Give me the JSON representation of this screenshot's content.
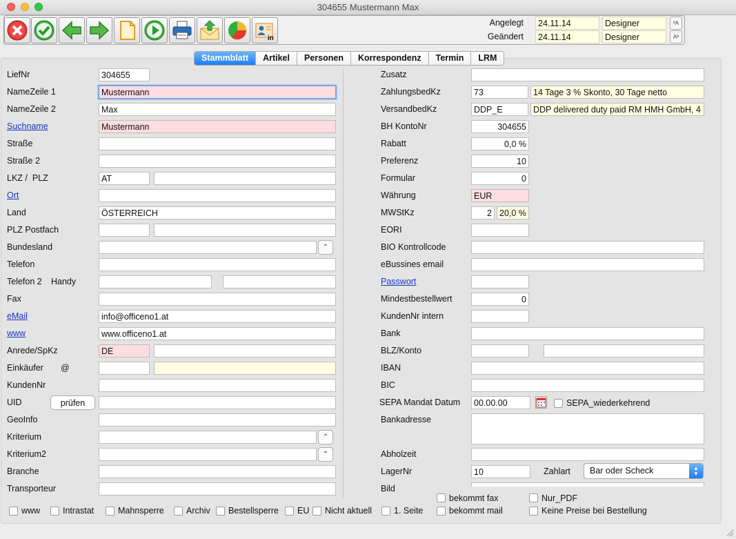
{
  "window": {
    "title": "304655 Mustermann Max"
  },
  "toolbar": {
    "buttons": [
      "cancel-icon",
      "check-icon",
      "back-arrow-icon",
      "forward-arrow-icon",
      "new-document-icon",
      "play-icon",
      "print-icon",
      "mail-upload-icon",
      "pie-chart-icon",
      "contact-card-icon"
    ]
  },
  "header": {
    "angelegt_label": "Angelegt",
    "angelegt_date": "24.11.14",
    "angelegt_user": "Designer",
    "geaendert_label": "Geändert",
    "geaendert_date": "24.11.14",
    "geaendert_user": "Designer"
  },
  "tabs": [
    "Stammblatt",
    "Artikel",
    "Personen",
    "Korrespondenz",
    "Termin",
    "LRM"
  ],
  "left": {
    "liefnr_label": "LiefNr",
    "liefnr": "304655",
    "name1_label": "NameZeile 1",
    "name1": "Mustermann",
    "name2_label": "NameZeile 2",
    "name2": "Max",
    "suchname_label": "Suchname",
    "suchname": "Mustermann",
    "strasse_label": "Straße",
    "strasse": "",
    "strasse2_label": "Straße 2",
    "strasse2": "",
    "lkzplz_label": "LKZ /  PLZ",
    "lkz": "AT",
    "plz": "",
    "ort_label": "Ort",
    "ort": "",
    "land_label": "Land",
    "land": "ÖSTERREICH",
    "plzpostfach_label": "PLZ Postfach",
    "bundesland_label": "Bundesland",
    "bundesland": "",
    "telefon_label": "Telefon",
    "telefon2_label": "Telefon 2",
    "handy_label": "Handy",
    "fax_label": "Fax",
    "email_label": "eMail",
    "email": "info@officeno1.at",
    "www_label": "www",
    "www": "www.officeno1.at",
    "anrede_label": "Anrede/SpKz",
    "anrede": "DE",
    "einkaeufer_label": "Einkäufer",
    "at_label": "@",
    "kundennr_label": "KundenNr",
    "uid_label": "UID",
    "pruefen_label": "prüfen",
    "geoinfo_label": "GeoInfo",
    "kriterium_label": "Kriterium",
    "kriterium2_label": "Kriterium2",
    "branche_label": "Branche",
    "transporteur_label": "Transporteur"
  },
  "right": {
    "zusatz_label": "Zusatz",
    "zahlungsbed_label": "ZahlungsbedKz",
    "zahlungsbed": "73",
    "zahlungsbed_text": "14 Tage 3 % Skonto, 30 Tage netto",
    "versandbed_label": "VersandbedKz",
    "versandbed": "DDP_E",
    "versandbed_text": "DDP delivered duty paid RM HMH GmbH, 4",
    "bhkonto_label": "BH KontoNr",
    "bhkonto": "304655",
    "rabatt_label": "Rabatt",
    "rabatt": "0,0 %",
    "preferenz_label": "Preferenz",
    "preferenz": "10",
    "formular_label": "Formular",
    "formular": "0",
    "waehrung_label": "Währung",
    "waehrung": "EUR",
    "mwst_label": "MWStKz",
    "mwst": "2",
    "mwst_pct": "20,0 %",
    "eori_label": "EORI",
    "bio_label": "BIO Kontrollcode",
    "ebusiness_label": "eBussines email",
    "passwort_label": "Passwort",
    "mindest_label": "Mindestbestellwert",
    "mindest": "0",
    "kundennrintern_label": "KundenNr intern",
    "bank_label": "Bank",
    "blz_label": "BLZ/Konto",
    "iban_label": "IBAN",
    "bic_label": "BIC",
    "sepa_label": "SEPA Mandat Datum",
    "sepa_date": "00.00.00",
    "sepa_wiederkehrend": "SEPA_wiederkehrend",
    "bankadresse_label": "Bankadresse",
    "abholzeit_label": "Abholzeit",
    "lagernr_label": "LagerNr",
    "lagernr": "10",
    "zahlart_label": "Zahlart",
    "zahlart": "Bar oder Scheck",
    "bild_label": "Bild"
  },
  "checkboxes": {
    "www": "www",
    "intrastat": "Intrastat",
    "mahnsperre": "Mahnsperre",
    "archiv": "Archiv",
    "bestellsperre": "Bestellsperre",
    "eu": "EU",
    "nicht_aktuell": "Nicht aktuell",
    "erste_seite": "1. Seite",
    "bekommt_fax": "bekommt fax",
    "bekommt_mail": "bekommt mail",
    "nur_pdf": "Nur_PDF",
    "keine_preise": "Keine Preise bei Bestellung"
  }
}
